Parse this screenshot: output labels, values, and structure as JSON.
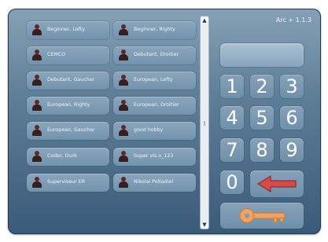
{
  "header": {
    "version": "Arc + 1.1.3"
  },
  "users": [
    "Beginner, Lefty",
    "Beginner, Righty",
    "CEMCO",
    "Debutant, Droitier",
    "Debutant, Gaucher",
    "European, Lefty",
    "European, Righty",
    "European, Droitier",
    "European, Gaucher",
    "good  hobby",
    "Coder, Durk",
    "Super vis.o_123",
    "Superviseur ER",
    "Nikolai Poltadiel"
  ],
  "keypad": {
    "keys": [
      "1",
      "2",
      "3",
      "4",
      "5",
      "6",
      "7",
      "8",
      "9",
      "0"
    ],
    "display_value": ""
  },
  "icons": {
    "user": "user-silhouette-icon",
    "backspace": "red-left-arrow-icon",
    "enter": "orange-key-icon",
    "scroll_up": "chevron-up-icon",
    "scroll_down": "chevron-down-icon"
  },
  "colors": {
    "backspace_arrow": "#d64a4a",
    "enter_key": "#f2a25e"
  }
}
